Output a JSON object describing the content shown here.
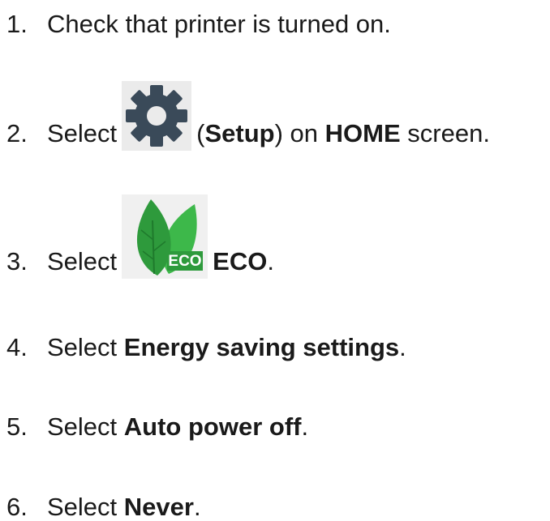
{
  "steps": [
    {
      "number": "1.",
      "parts": [
        {
          "text": "Check that printer is turned on.",
          "bold": false
        }
      ]
    },
    {
      "number": "2.",
      "parts": [
        {
          "text": "Select",
          "bold": false
        },
        {
          "text": "(",
          "bold": false
        },
        {
          "text": "Setup",
          "bold": true
        },
        {
          "text": ") on ",
          "bold": false
        },
        {
          "text": "HOME",
          "bold": true
        },
        {
          "text": " screen.",
          "bold": false
        }
      ],
      "icon": "gear-icon"
    },
    {
      "number": "3.",
      "parts": [
        {
          "text": "Select",
          "bold": false
        },
        {
          "text": "ECO",
          "bold": true
        },
        {
          "text": ".",
          "bold": false
        }
      ],
      "icon": "eco-leaf-icon",
      "icon_label": "ECO"
    },
    {
      "number": "4.",
      "parts": [
        {
          "text": "Select ",
          "bold": false
        },
        {
          "text": "Energy saving settings",
          "bold": true
        },
        {
          "text": ".",
          "bold": false
        }
      ]
    },
    {
      "number": "5.",
      "parts": [
        {
          "text": "Select ",
          "bold": false
        },
        {
          "text": "Auto power off",
          "bold": true
        },
        {
          "text": ".",
          "bold": false
        }
      ]
    },
    {
      "number": "6.",
      "parts": [
        {
          "text": "Select ",
          "bold": false
        },
        {
          "text": "Never",
          "bold": true
        },
        {
          "text": ".",
          "bold": false
        }
      ]
    }
  ],
  "colors": {
    "text": "#1a1a1a",
    "gear": "#3a4a59",
    "leaf_dark": "#2e9a3c",
    "leaf_light": "#3db84a",
    "icon_bg": "#ebebeb"
  }
}
